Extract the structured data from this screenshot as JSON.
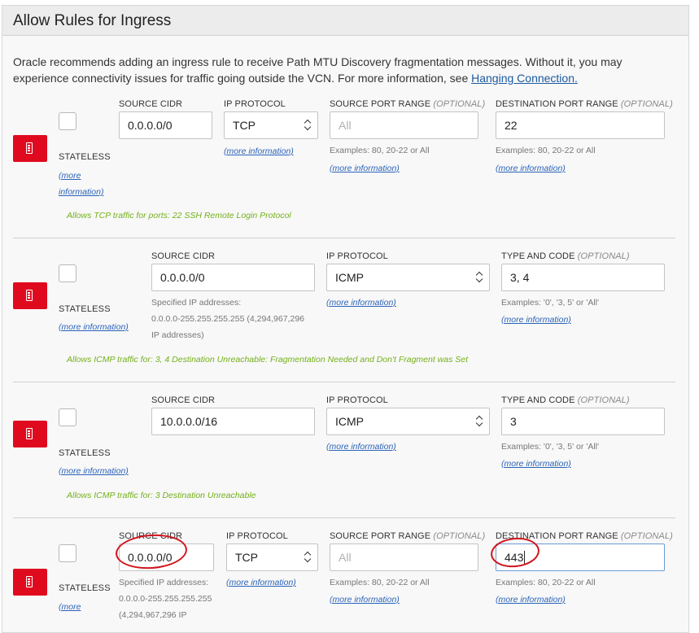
{
  "panel": {
    "title": "Allow Rules for Ingress",
    "intro_text": "Oracle recommends adding an ingress rule to receive Path MTU Discovery fragmentation messages. Without it, you may experience connectivity issues for traffic going outside the VCN. For more information, see ",
    "intro_link": "Hanging Connection."
  },
  "common": {
    "stateless": "STATELESS",
    "more_information": "(more information)",
    "more": "(more",
    "information": "information)",
    "source_cidr": "SOURCE CIDR",
    "ip_protocol": "IP PROTOCOL",
    "source_port_range": "SOURCE PORT RANGE",
    "destination_port_range": "DESTINATION PORT RANGE",
    "type_and_code": "TYPE AND CODE",
    "optional": "(OPTIONAL)",
    "port_examples": "Examples: 80, 20-22 or All",
    "type_examples": "Examples: '0', '3, 5' or 'All'",
    "specified_ip_1": "Specified IP addresses:",
    "specified_ip_2": "0.0.0.0-255.255.255.255 (4,294,967,296",
    "specified_ip_3": "IP addresses)",
    "specified_ip_2a": "0.0.0.0-255.255.255.255",
    "specified_ip_3a": "(4,294,967,296 IP",
    "all_placeholder": "All"
  },
  "rules": [
    {
      "source_cidr": "0.0.0.0/0",
      "ip_protocol": "TCP",
      "destination_port_range": "22",
      "allows": "Allows TCP traffic for ports: 22 SSH Remote Login Protocol"
    },
    {
      "source_cidr": "0.0.0.0/0",
      "ip_protocol": "ICMP",
      "type_and_code": "3, 4",
      "allows": "Allows ICMP traffic for: 3, 4 Destination Unreachable: Fragmentation Needed and Don't Fragment was Set"
    },
    {
      "source_cidr": "10.0.0.0/16",
      "ip_protocol": "ICMP",
      "type_and_code": "3",
      "allows": "Allows ICMP traffic for: 3 Destination Unreachable"
    },
    {
      "source_cidr": "0.0.0.0/0",
      "ip_protocol": "TCP",
      "destination_port_range": "443"
    }
  ],
  "colors": {
    "delete_button": "#e00a1f",
    "link": "#2a62b8",
    "allows_text": "#74b01a",
    "annotation_circle": "#d0151d"
  }
}
